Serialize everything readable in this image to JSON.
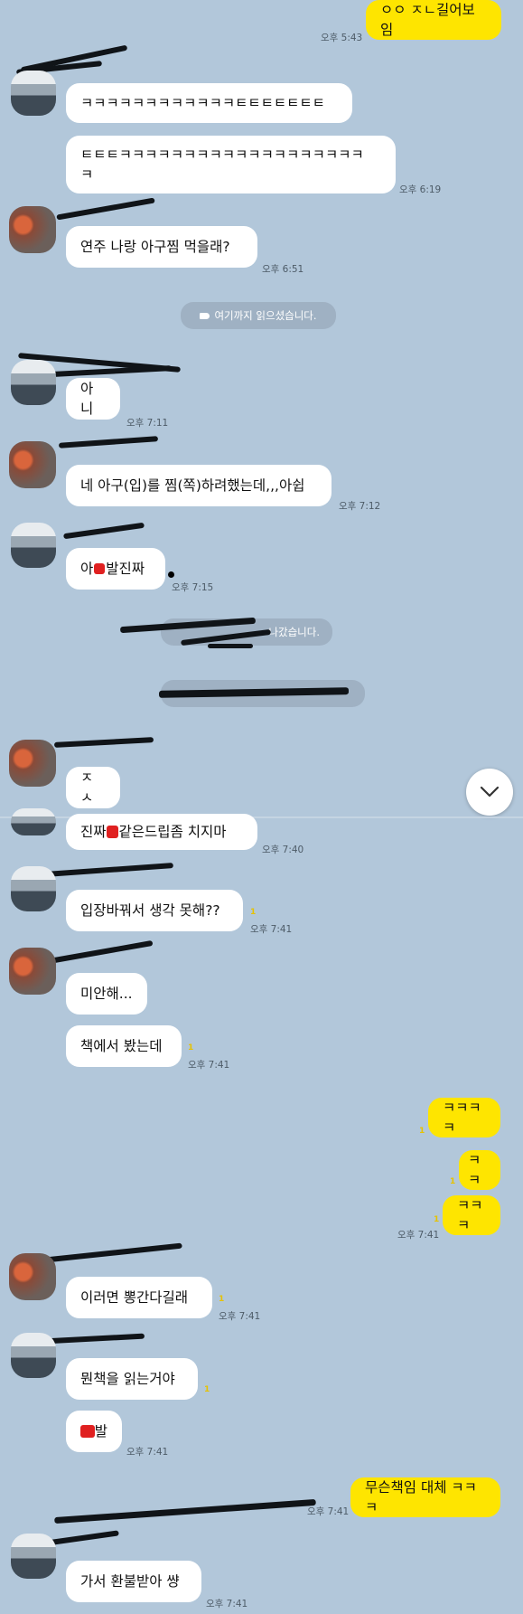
{
  "messages": {
    "m1": "ㅇㅇ ㅈㄴ길어보임",
    "m2": "ㅋㅋㅋㅋㅋㅋㅋㅋㅋㅋㅋㅋㅌㅌㅌㅌㅌㅌㅌ",
    "m3a": "ㅌㅌㅌㅋㅋㅋㅋㅋㅋㅋㅋㅋㅋㅋㅋㅋㅋㅋㅋㅋㅋㅋ",
    "m3b": "ㅋ",
    "m4": "연주 나랑 아구찜 먹을래?",
    "m5": "아니",
    "m6": "네 아구(입)를 찜(쪽)하려했는데,,,아쉽",
    "m7a": "아 ",
    "m7b": "발진짜",
    "m8": "ㅈㅅ",
    "m9a": "진짜 ",
    "m9b": "같은드립좀 치지마",
    "m10": "입장바꿔서 생각 못해??",
    "m11": "미안해...",
    "m12": "책에서 봤는데",
    "m13": "ㅋㅋㅋㅋ",
    "m14": "ㅋㅋ",
    "m15": "ㅋㅋㅋ",
    "m16": "이러면 뽕간다길래",
    "m17": "뭔책을 읽는거야",
    "m18": "발",
    "m19": "무슨책임 대체 ㅋㅋㅋ",
    "m20": "가서 환불받아 썅"
  },
  "times": {
    "t1": "오후 5:43",
    "t2": "오후 6:19",
    "t3": "오후 6:51",
    "t4": "오후 7:11",
    "t5": "오후 7:12",
    "t6": "오후 7:15",
    "t7": "오후 7:40",
    "t8": "오후 7:41"
  },
  "unread_marks": {
    "one": "1"
  },
  "notices": {
    "read_here": "여기까지 읽으셨습니다.",
    "left": "나갔습니다."
  },
  "icons": {
    "scroll_down": "chevron-down-icon",
    "read_marker": "tag-icon"
  },
  "colors": {
    "background": "#b2c7da",
    "outgoing_bubble": "#fee500",
    "incoming_bubble": "#ffffff",
    "unread": "#e6c200"
  }
}
